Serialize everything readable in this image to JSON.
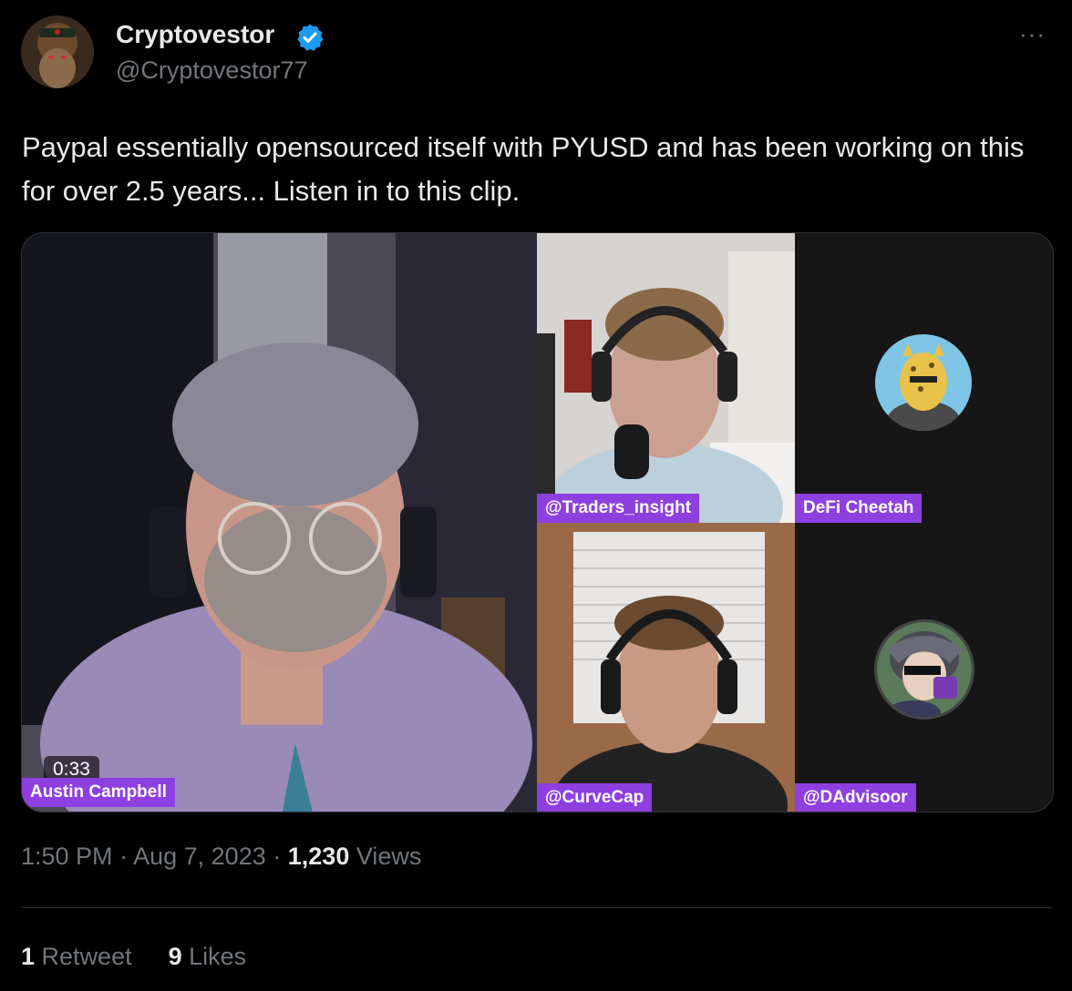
{
  "author": {
    "display_name": "Cryptovestor",
    "handle": "@Cryptovestor77",
    "verified_color": "#1d9bf0"
  },
  "more_label": "···",
  "tweet": {
    "text": "Paypal essentially opensourced itself with PYUSD and has been working on this for over 2.5 years... Listen in to this clip."
  },
  "video": {
    "duration": "0:33",
    "participants": [
      {
        "label": "Austin Campbell"
      },
      {
        "label": "@Traders_insight"
      },
      {
        "label": "DeFi Cheetah"
      },
      {
        "label": "@CurveCap"
      },
      {
        "label": "@DAdvisoor"
      }
    ],
    "tag_color": "#8e3fe0"
  },
  "meta": {
    "time": "1:50 PM",
    "separator": "·",
    "date": "Aug 7, 2023",
    "views_count": "1,230",
    "views_label": "Views"
  },
  "engagement": {
    "retweets_count": "1",
    "retweets_label": "Retweet",
    "likes_count": "9",
    "likes_label": "Likes"
  }
}
